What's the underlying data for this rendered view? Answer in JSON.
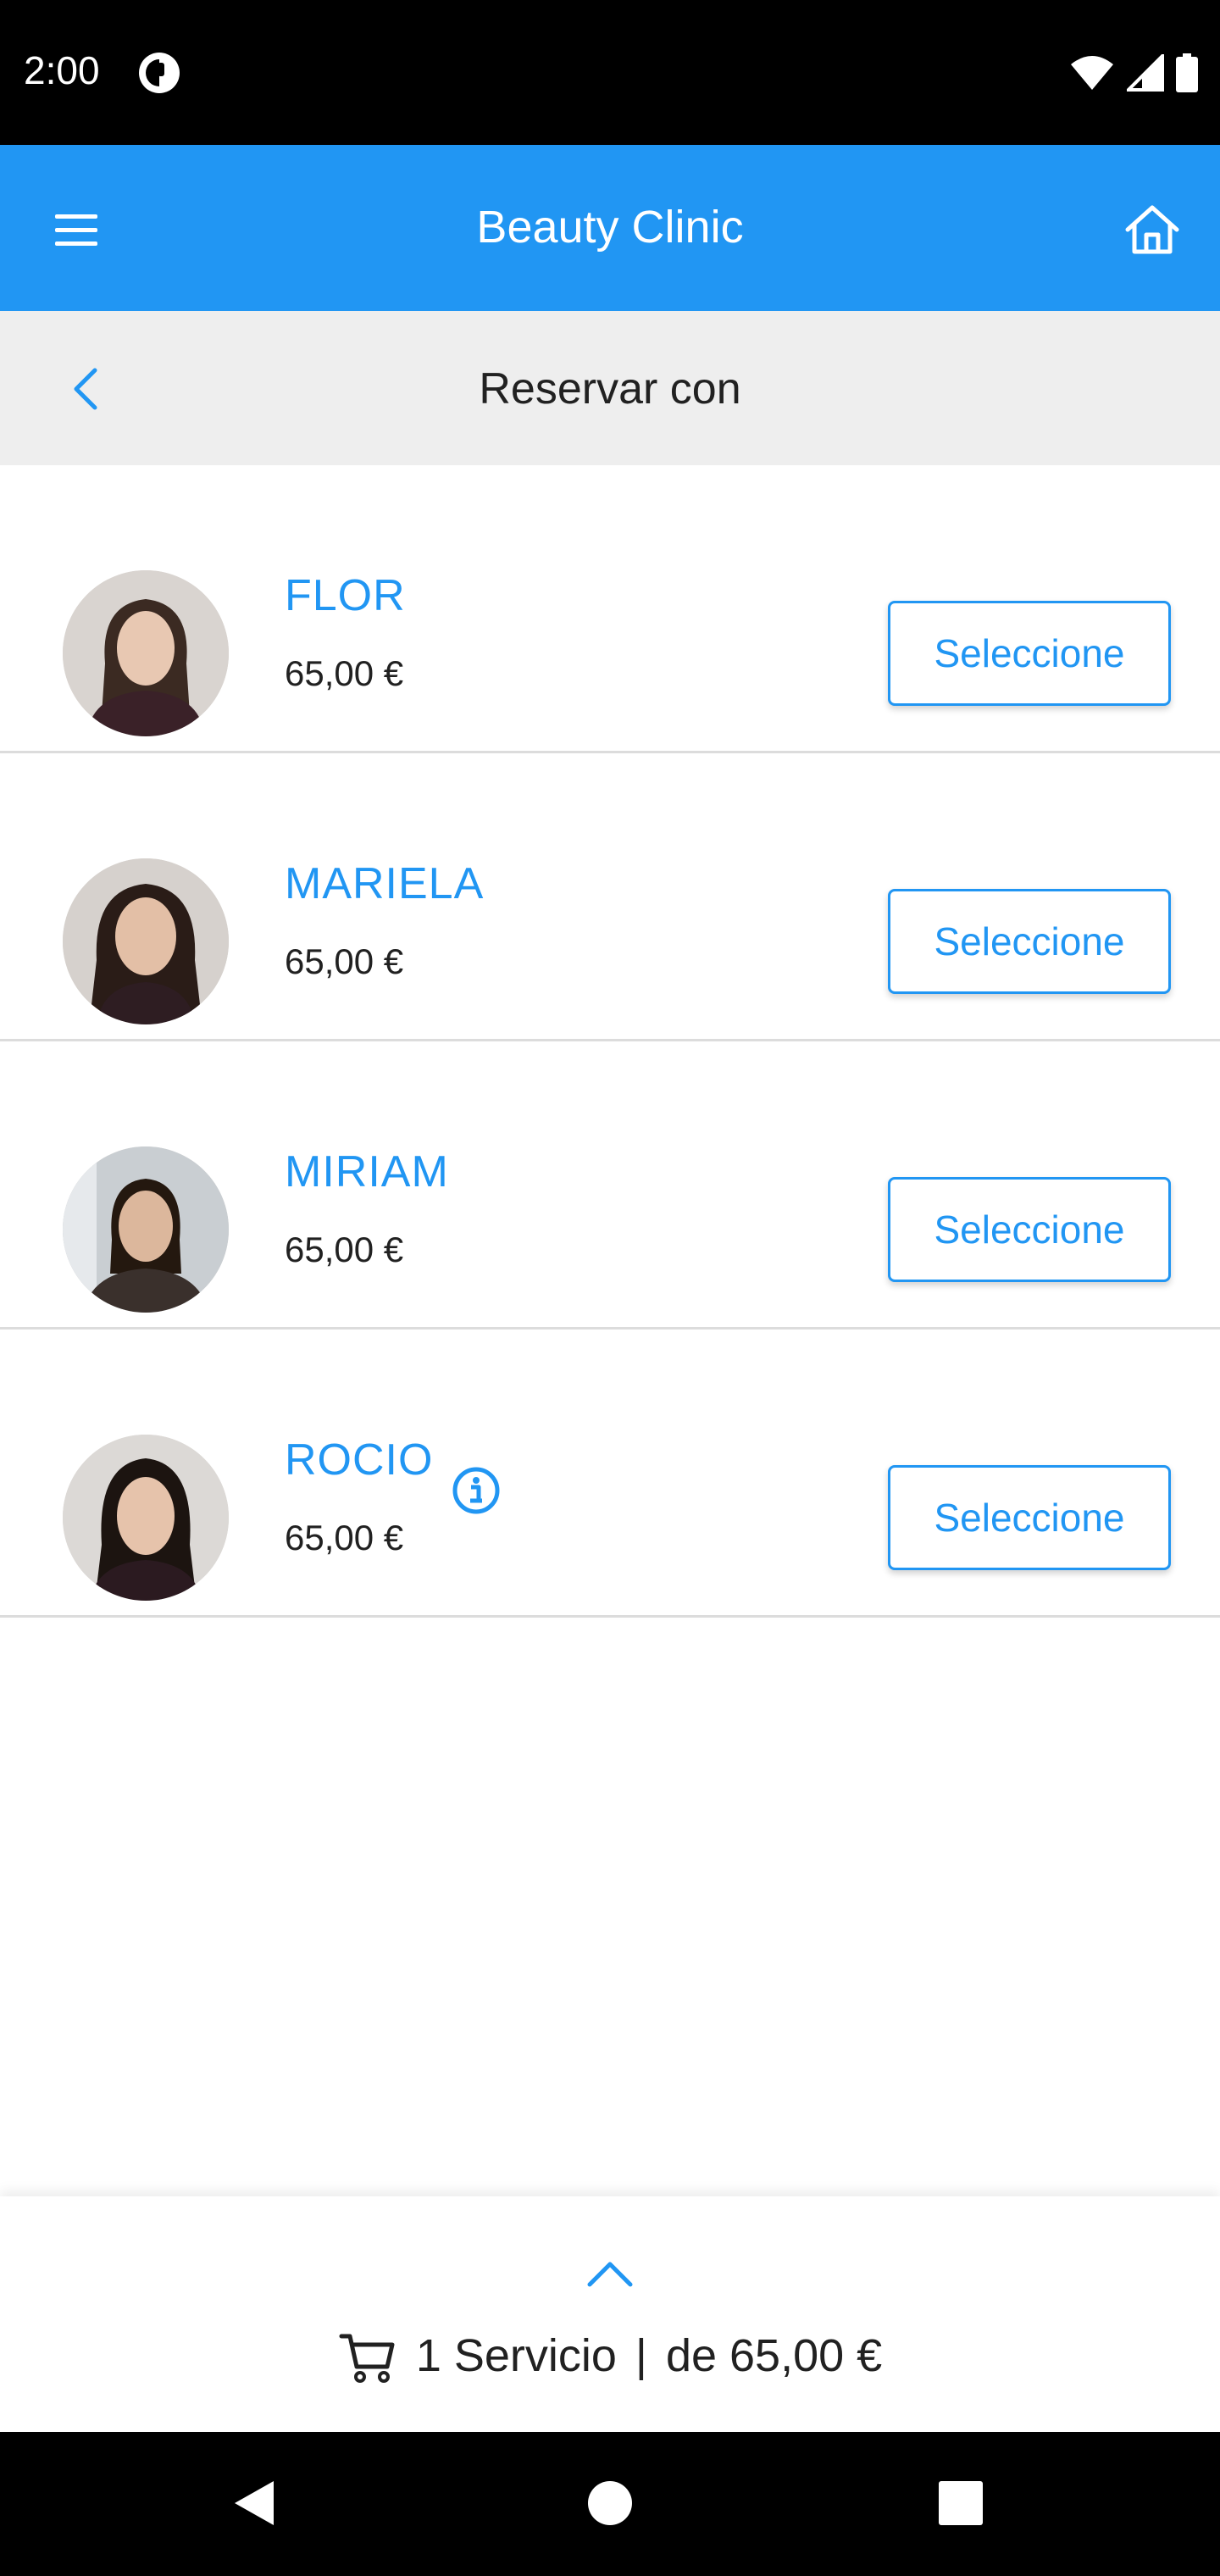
{
  "status_bar": {
    "time": "2:00"
  },
  "app_bar": {
    "title": "Beauty Clinic"
  },
  "sub_header": {
    "title": "Reservar con"
  },
  "staff": [
    {
      "name": "FLOR",
      "price": "65,00 €",
      "button": "Seleccione",
      "has_info": false,
      "hair": "#3b2a22",
      "skin": "#e8c8b2"
    },
    {
      "name": "MARIELA",
      "price": "65,00 €",
      "button": "Seleccione",
      "has_info": false,
      "hair": "#2a1c17",
      "skin": "#e3bfa6"
    },
    {
      "name": "MIRIAM",
      "price": "65,00 €",
      "button": "Seleccione",
      "has_info": false,
      "hair": "#24180f",
      "skin": "#dcb79c"
    },
    {
      "name": "ROCIO",
      "price": "65,00 €",
      "button": "Seleccione",
      "has_info": true,
      "hair": "#1c1410",
      "skin": "#e6c3ab"
    }
  ],
  "cart": {
    "count_label": "1 Servicio",
    "separator": "|",
    "total_label": "de 65,00 €"
  },
  "colors": {
    "primary": "#2196f3",
    "status_bar": "#000000",
    "sub_header_bg": "#eeeeee",
    "text": "#212121",
    "divider": "#dcdcdc"
  },
  "icons": {
    "menu": "hamburger-menu-icon",
    "home": "home-icon",
    "back": "chevron-left-icon",
    "info": "info-icon",
    "cart": "shopping-cart-icon",
    "expand": "chevron-up-icon"
  }
}
